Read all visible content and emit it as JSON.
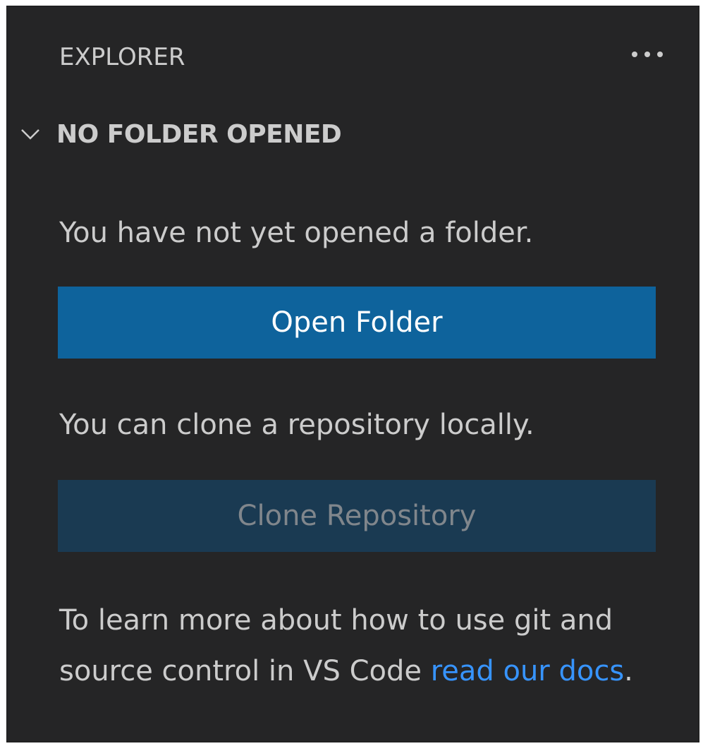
{
  "explorer": {
    "title": "EXPLORER",
    "more_actions_icon": "ellipsis-icon"
  },
  "section": {
    "chevron_icon": "chevron-down-icon",
    "title": "NO FOLDER OPENED"
  },
  "welcome": {
    "no_folder_message": "You have not yet opened a folder.",
    "open_folder_label": "Open Folder",
    "clone_message": "You can clone a repository locally.",
    "clone_repository_label": "Clone Repository",
    "learn_more_prefix": "To learn more about how to use git and source control in VS Code ",
    "docs_link_label": "read our docs",
    "learn_more_suffix": "."
  },
  "colors": {
    "panel_background": "#252526",
    "primary_button": "#0e639c",
    "disabled_button": "#1a3a52",
    "link": "#3794ff",
    "text": "#cccccc"
  }
}
